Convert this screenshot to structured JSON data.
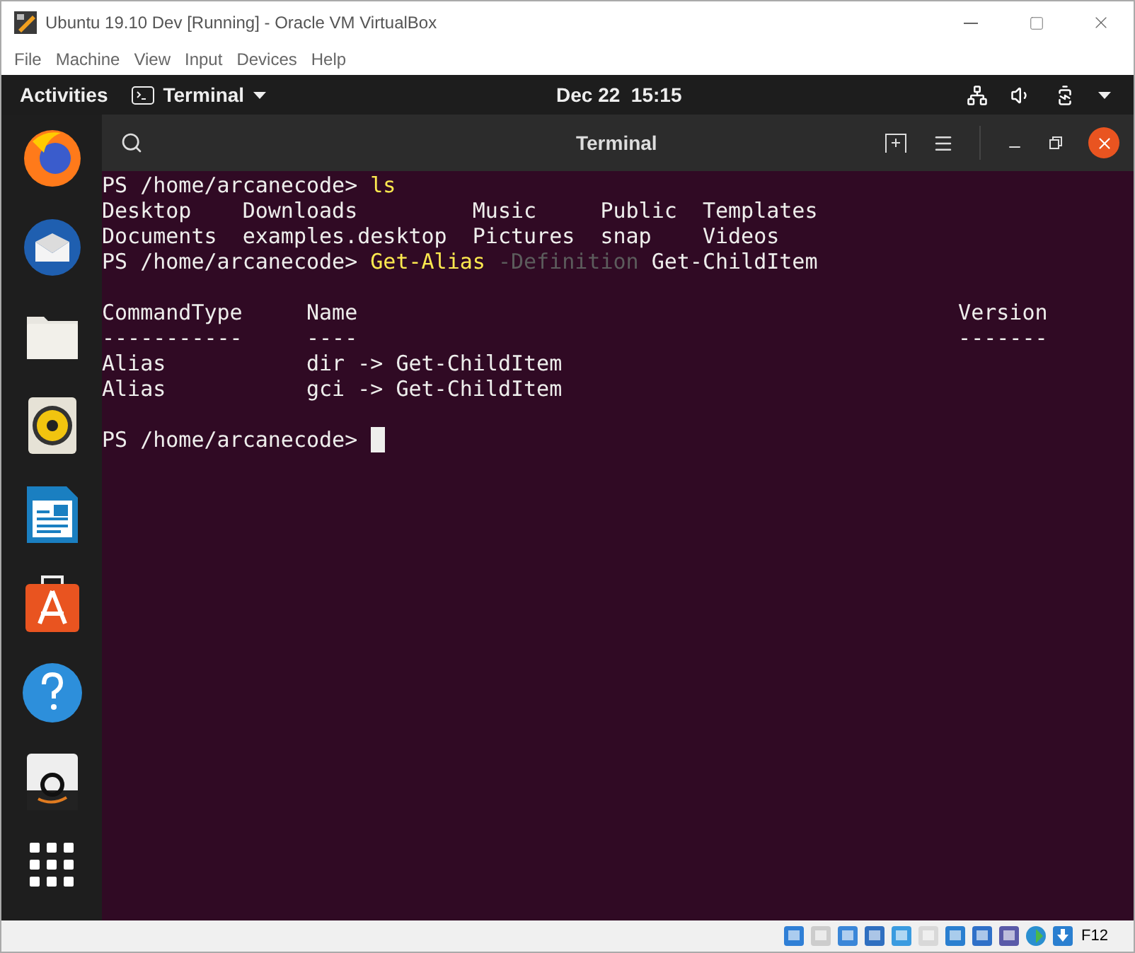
{
  "window": {
    "title": "Ubuntu 19.10 Dev [Running] - Oracle VM VirtualBox"
  },
  "menu": [
    "File",
    "Machine",
    "View",
    "Input",
    "Devices",
    "Help"
  ],
  "top_bar": {
    "activities": "Activities",
    "app_menu": "Terminal",
    "clock": "Dec 22  15:15"
  },
  "terminal": {
    "title": "Terminal",
    "cursor_visible": true,
    "lines": [
      {
        "kind": "text",
        "segments": [
          {
            "text": "PS /home/arcanecode> ",
            "kind": "plain"
          },
          {
            "text": "ls",
            "kind": "command"
          }
        ]
      },
      {
        "kind": "text",
        "segments": [
          {
            "text": "Desktop    Downloads         Music     Public  Templates",
            "kind": "plain"
          }
        ]
      },
      {
        "kind": "text",
        "segments": [
          {
            "text": "Documents  examples.desktop  Pictures  snap    Videos",
            "kind": "plain"
          }
        ]
      },
      {
        "kind": "text",
        "segments": [
          {
            "text": "PS /home/arcanecode> ",
            "kind": "plain"
          },
          {
            "text": "Get-Alias",
            "kind": "command"
          },
          {
            "text": " -Definition",
            "kind": "parameter"
          },
          {
            "text": " Get-ChildItem",
            "kind": "plain"
          }
        ]
      },
      {
        "kind": "blank"
      },
      {
        "kind": "text",
        "segments": [
          {
            "text": "CommandType     Name                                               Version",
            "kind": "plain"
          }
        ]
      },
      {
        "kind": "text",
        "segments": [
          {
            "text": "-----------     ----                                               -------",
            "kind": "plain"
          }
        ]
      },
      {
        "kind": "text",
        "segments": [
          {
            "text": "Alias           dir -> Get-ChildItem",
            "kind": "plain"
          }
        ]
      },
      {
        "kind": "text",
        "segments": [
          {
            "text": "Alias           gci -> Get-ChildItem",
            "kind": "plain"
          }
        ]
      },
      {
        "kind": "blank"
      },
      {
        "kind": "text",
        "segments": [
          {
            "text": "PS /home/arcanecode> ",
            "kind": "plain"
          }
        ]
      }
    ]
  },
  "status_bar": {
    "host_key": "F12"
  }
}
